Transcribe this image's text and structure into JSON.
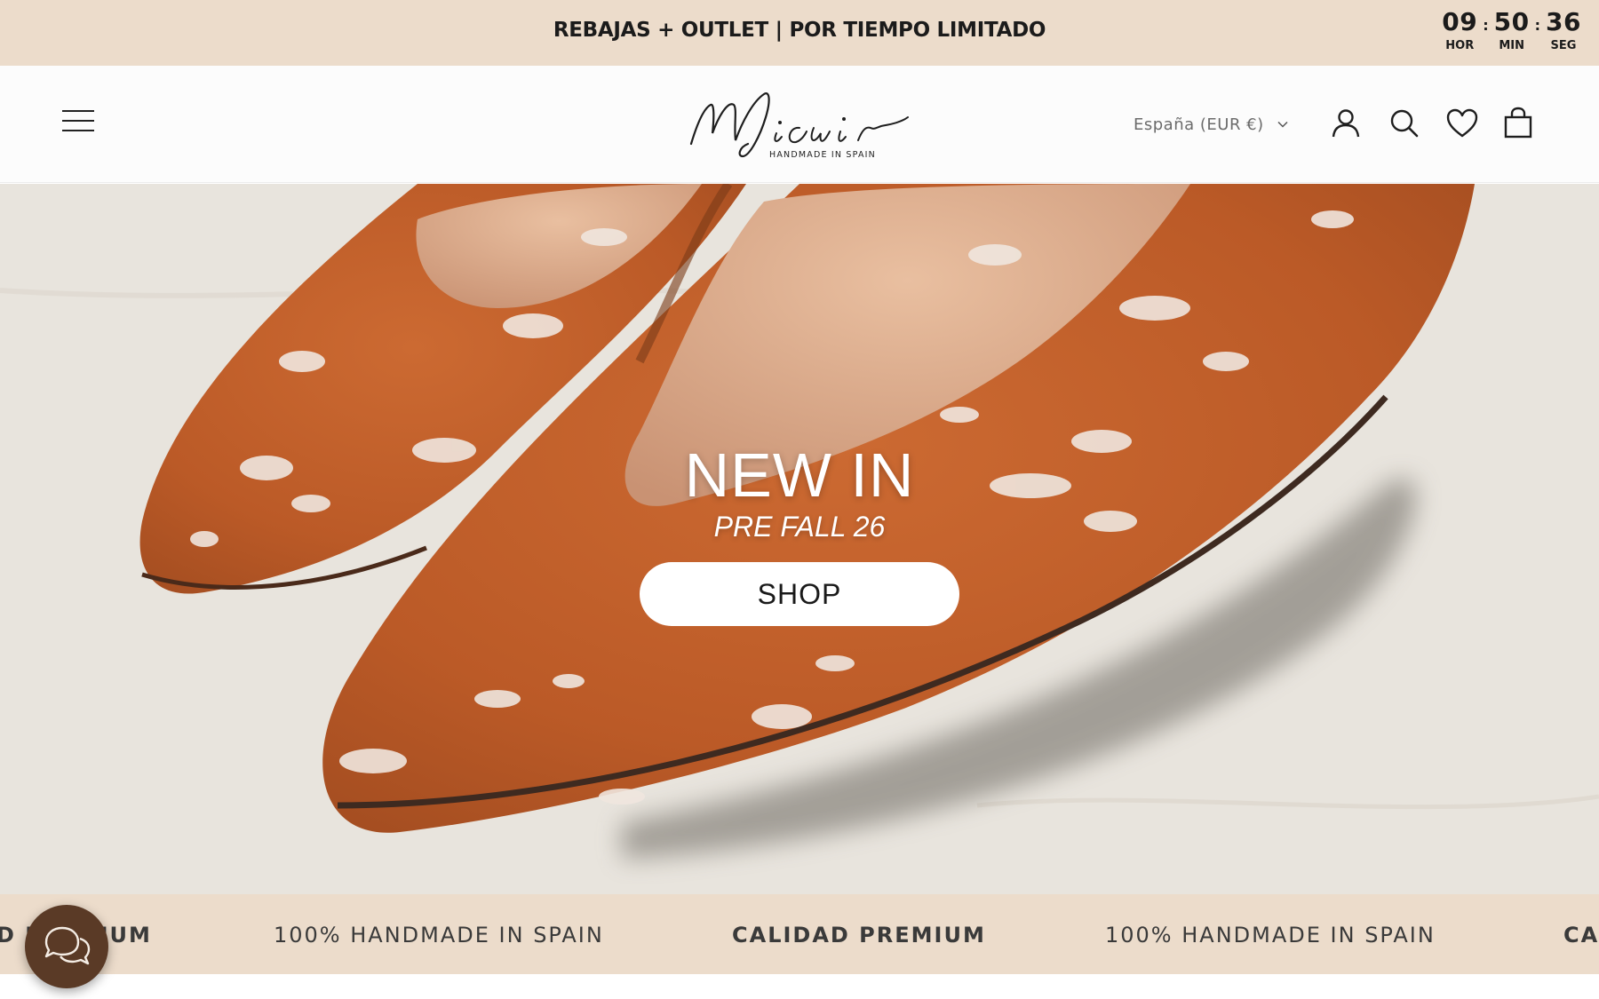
{
  "announcement": {
    "text": "REBAJAS + OUTLET | POR TIEMPO LIMITADO",
    "countdown": {
      "hours": "09",
      "minutes": "50",
      "seconds": "36",
      "hours_label": "HOR",
      "minutes_label": "MIN",
      "seconds_label": "SEG"
    }
  },
  "header": {
    "logo_text": "Micuir",
    "logo_tagline": "HANDMADE IN SPAIN",
    "locale": "España (EUR €)",
    "icons": [
      "menu-icon",
      "account-icon",
      "search-icon",
      "wishlist-heart-icon",
      "cart-bag-icon"
    ]
  },
  "hero": {
    "title": "NEW IN",
    "subtitle": "PRE FALL 26",
    "button_label": "SHOP"
  },
  "marquee": {
    "items": [
      "D PREMIUM",
      "100% HANDMADE IN SPAIN",
      "CALIDAD PREMIUM",
      "100% HANDMADE IN SPAIN",
      "CA"
    ]
  },
  "colors": {
    "announcement_bg": "#ecdccb",
    "marquee_bg": "#ecdccb",
    "chat_button": "#5a3a26",
    "shoe_leather": "#c0602c"
  }
}
